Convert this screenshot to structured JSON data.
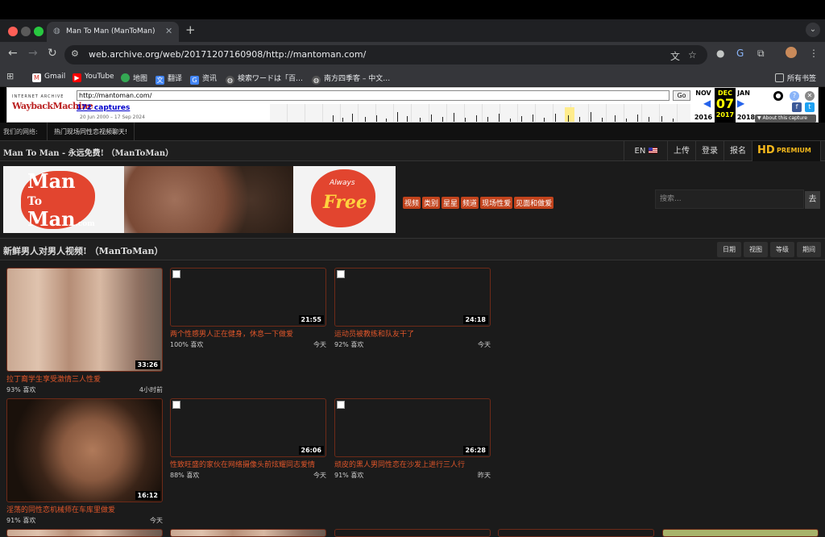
{
  "browser": {
    "tab_title": "Man To Man (ManToMan)",
    "url": "web.archive.org/web/20171207160908/http://mantoman.com/",
    "bookmarks": [
      {
        "label": "Gmail",
        "icon": "gmail-icon"
      },
      {
        "label": "YouTube",
        "icon": "youtube-icon"
      },
      {
        "label": "地图",
        "icon": "maps-icon"
      },
      {
        "label": "翻译",
        "icon": "translate-icon"
      },
      {
        "label": "资讯",
        "icon": "news-icon"
      },
      {
        "label": "検索ワードは「百…",
        "icon": "globe-icon"
      },
      {
        "label": "南方四季客 – 中文…",
        "icon": "globe-icon"
      }
    ],
    "all_bookmarks": "所有书签"
  },
  "wayback": {
    "url_value": "http://mantoman.com/",
    "go_label": "Go",
    "captures": "172 captures",
    "range": "20 Jun 2000 – 17 Sep 2024",
    "prev": {
      "month": "NOV",
      "year": "2016"
    },
    "current": {
      "month": "DEC",
      "day": "07",
      "year": "2017"
    },
    "next": {
      "month": "JAN",
      "year": "2018"
    },
    "about": "▼ About this capture"
  },
  "site": {
    "network_label": "我们的网络:",
    "network_link": "热门现场同性恋视频聊天!",
    "header_title": "Man To Man - 永远免费! （ManToMan）",
    "lang": "EN",
    "upload": "上传",
    "login": "登录",
    "signup": "报名",
    "hd": "HD",
    "premium": "PREMIUM",
    "banner": {
      "logo": "Man To Man",
      "dotcom": ".com",
      "always": "Always",
      "free": "Free"
    },
    "categories": [
      "视频",
      "类别",
      "星星",
      "频道",
      "现场性爱",
      "见面和做爱"
    ],
    "search_placeholder": "搜索...",
    "search_go": "去",
    "section_title": "新鲜男人对男人视频! （ManToMan）",
    "sort": [
      "日期",
      "视图",
      "等级",
      "期间"
    ],
    "videos": [
      {
        "title": "拉丁裔学生享受激情三人性爱",
        "duration": "33:26",
        "likes": "93% 喜欢",
        "time": "4小时前"
      },
      {
        "title": "两个性感男人正在健身，休息一下做爱",
        "duration": "21:55",
        "likes": "100% 喜欢",
        "time": "今天"
      },
      {
        "title": "运动员被教练和队友干了",
        "duration": "24:18",
        "likes": "92% 喜欢",
        "time": "今天"
      },
      {
        "title": "淫荡的同性恋机械师在车库里做爱",
        "duration": "16:12",
        "likes": "91% 喜欢",
        "time": "今天"
      },
      {
        "title": "性致旺盛的家伙在网络摄像头前炫耀同志爱情",
        "duration": "26:06",
        "likes": "88% 喜欢",
        "time": "今天"
      },
      {
        "title": "顽皮的黑人男同性恋在沙发上进行三人行",
        "duration": "26:28",
        "likes": "91% 喜欢",
        "time": "昨天"
      }
    ]
  }
}
